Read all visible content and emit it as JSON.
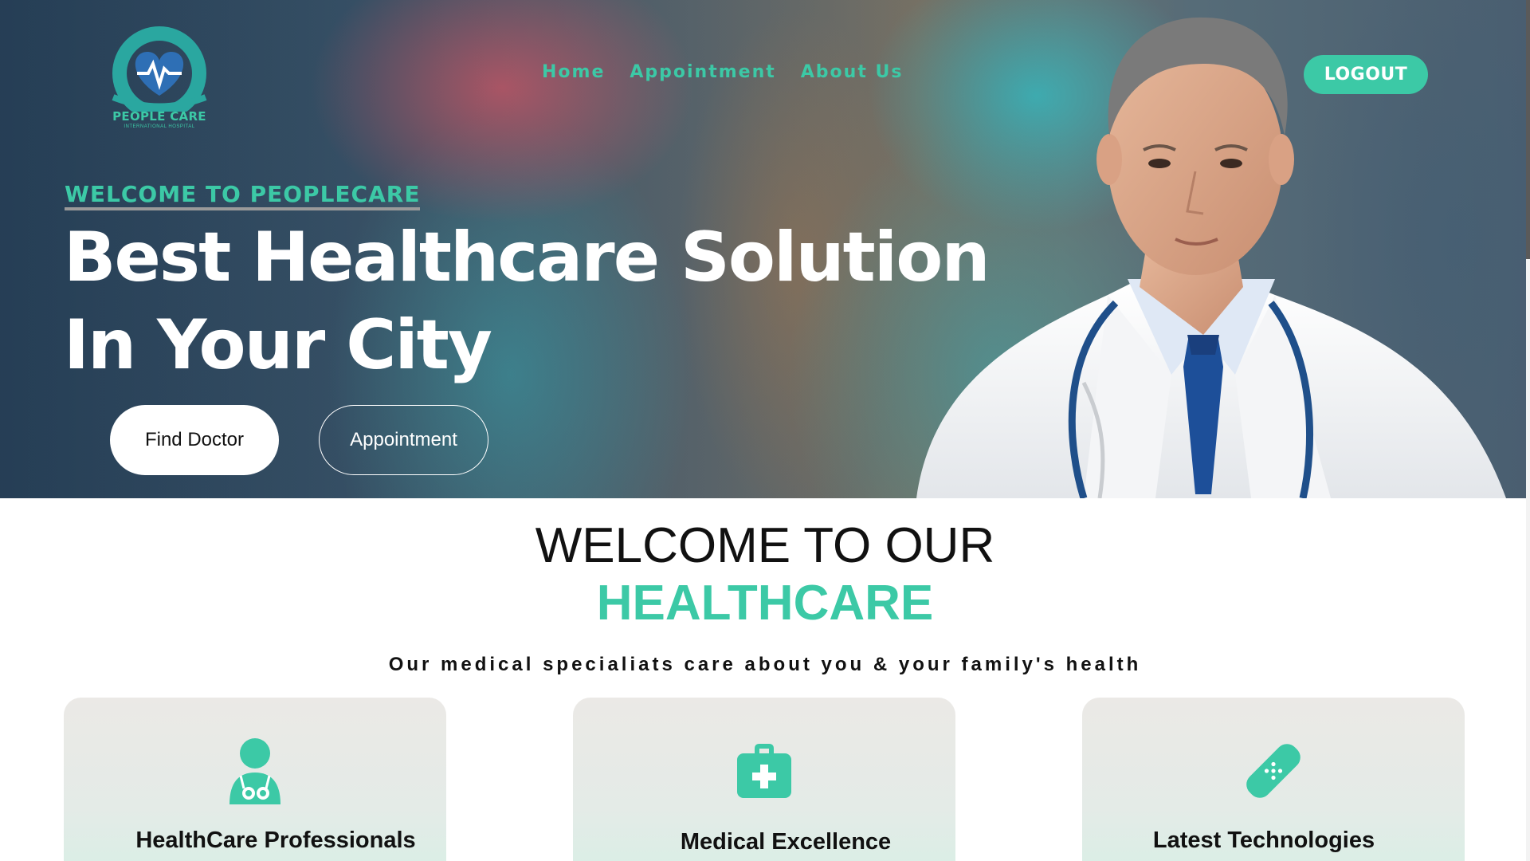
{
  "colors": {
    "accent": "#3cc9a6",
    "text": "#111111",
    "white": "#ffffff"
  },
  "logo": {
    "arc_text": "PEOPLE CARE INTERNATIONAL HOSPITAL",
    "name": "PEOPLE CARE",
    "sub": "INTERNATIONAL HOSPITAL",
    "icon": "heart-pulse-icon"
  },
  "nav": {
    "items": [
      "Home",
      "Appointment",
      "About Us"
    ],
    "logout": "LOGOUT"
  },
  "hero": {
    "kicker": "WELCOME TO PEOPLECARE",
    "headline_line1": "Best Healthcare Solution",
    "headline_line2": "In Your City",
    "find_doctor": "Find Doctor",
    "appointment": "Appointment"
  },
  "welcome": {
    "title_line1": "WELCOME TO OUR",
    "title_line2": "HEALTHCARE",
    "subtitle": "Our medical specialiats care about you & your family's health"
  },
  "features": [
    {
      "label": "HealthCare Professionals",
      "icon": "doctor-icon"
    },
    {
      "label": "Medical Excellence",
      "icon": "medical-kit-icon"
    },
    {
      "label": "Latest Technologies",
      "icon": "bandage-icon"
    }
  ]
}
